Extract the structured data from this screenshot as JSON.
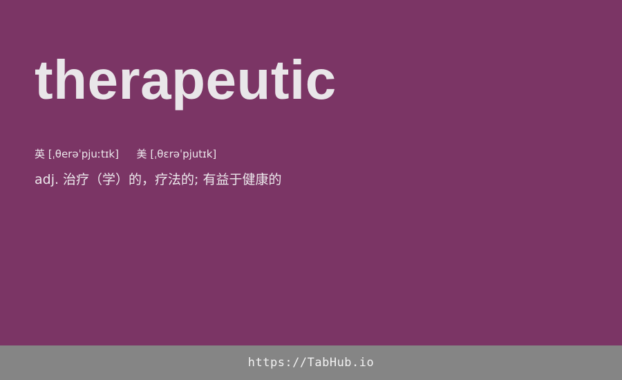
{
  "entry": {
    "word": "therapeutic",
    "phonetic_uk_label": "英",
    "phonetic_uk": "[ˌθerəˈpjuːtɪk]",
    "phonetic_us_label": "美",
    "phonetic_us": "[ˌθɛrəˈpjutɪk]",
    "definition": "adj. 治疗（学）的，疗法的; 有益于健康的"
  },
  "footer": {
    "link_text": "https://TabHub.io"
  },
  "colors": {
    "background": "#7b3565",
    "footer_background": "#858585",
    "text": "#ece8ec"
  }
}
